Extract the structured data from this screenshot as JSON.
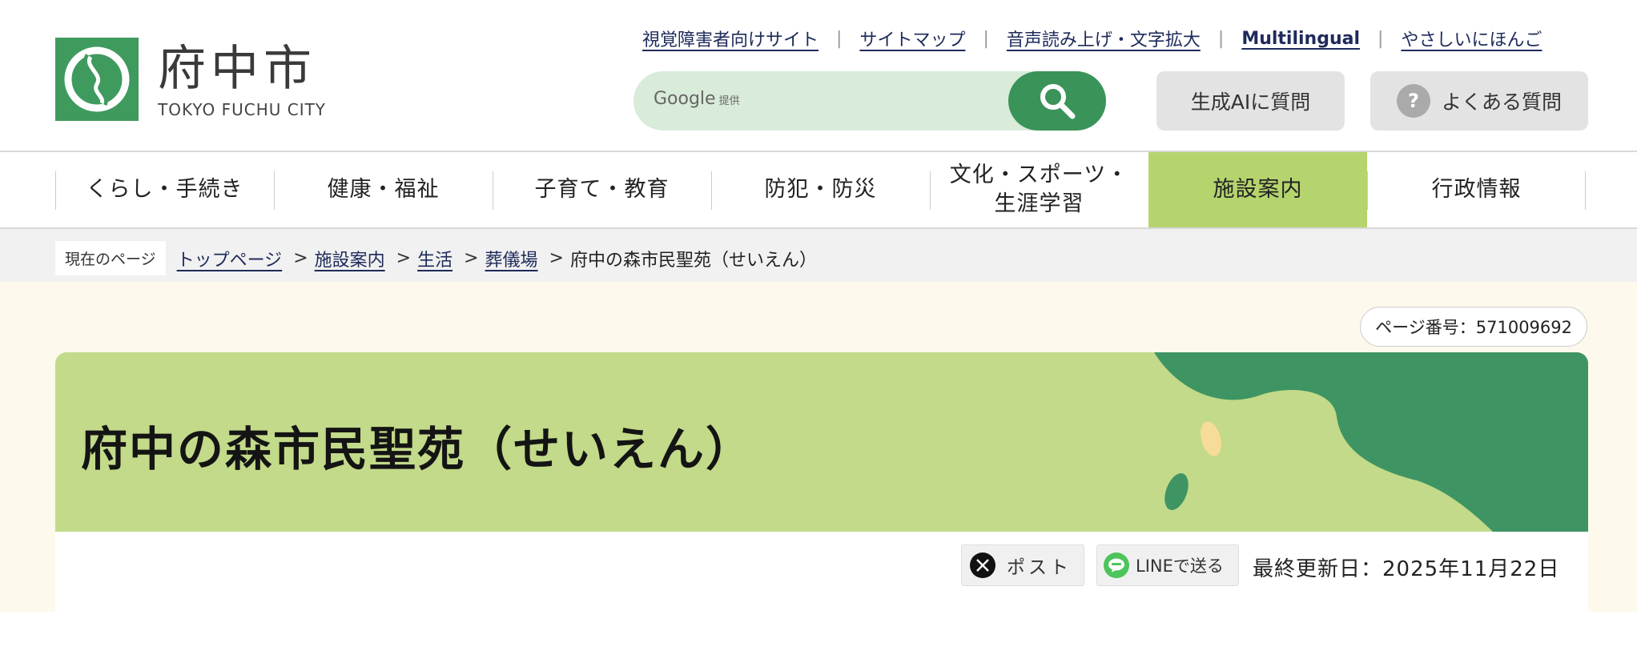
{
  "header": {
    "logo_jp": "府中市",
    "logo_en": "TOKYO FUCHU CITY",
    "util_links": [
      "視覚障害者向けサイト",
      "サイトマップ",
      "音声読み上げ・文字拡大",
      "Multilingual",
      "やさしいにほんご"
    ],
    "search": {
      "brand": "Google",
      "brand_suffix": "提供"
    },
    "ai_button": "生成AIに質問",
    "faq_button": "よくある質問",
    "faq_icon_glyph": "?"
  },
  "nav": {
    "items": [
      "くらし・手続き",
      "健康・福祉",
      "子育て・教育",
      "防犯・防災",
      "文化・スポーツ・生涯学習",
      "施設案内",
      "行政情報"
    ],
    "item5_line1": "文化・スポーツ・",
    "item5_line2": "生涯学習",
    "active": "施設案内"
  },
  "breadcrumb": {
    "label": "現在のページ",
    "links": [
      "トップページ",
      "施設案内",
      "生活",
      "葬儀場"
    ],
    "separator": ">",
    "current": "府中の森市民聖苑（せいえん）"
  },
  "page": {
    "page_number": "ページ番号：571009692",
    "title": "府中の森市民聖苑（せいえん）",
    "share_x": "ポスト",
    "share_line": "LINEで送る",
    "updated": "最終更新日：2025年11月22日"
  },
  "colors": {
    "brand_green": "#3f9a5e",
    "nav_active": "#b5d46e",
    "hero_bg": "#c2da89",
    "page_bg": "#fdf9ec",
    "link": "#1e2a5a"
  }
}
